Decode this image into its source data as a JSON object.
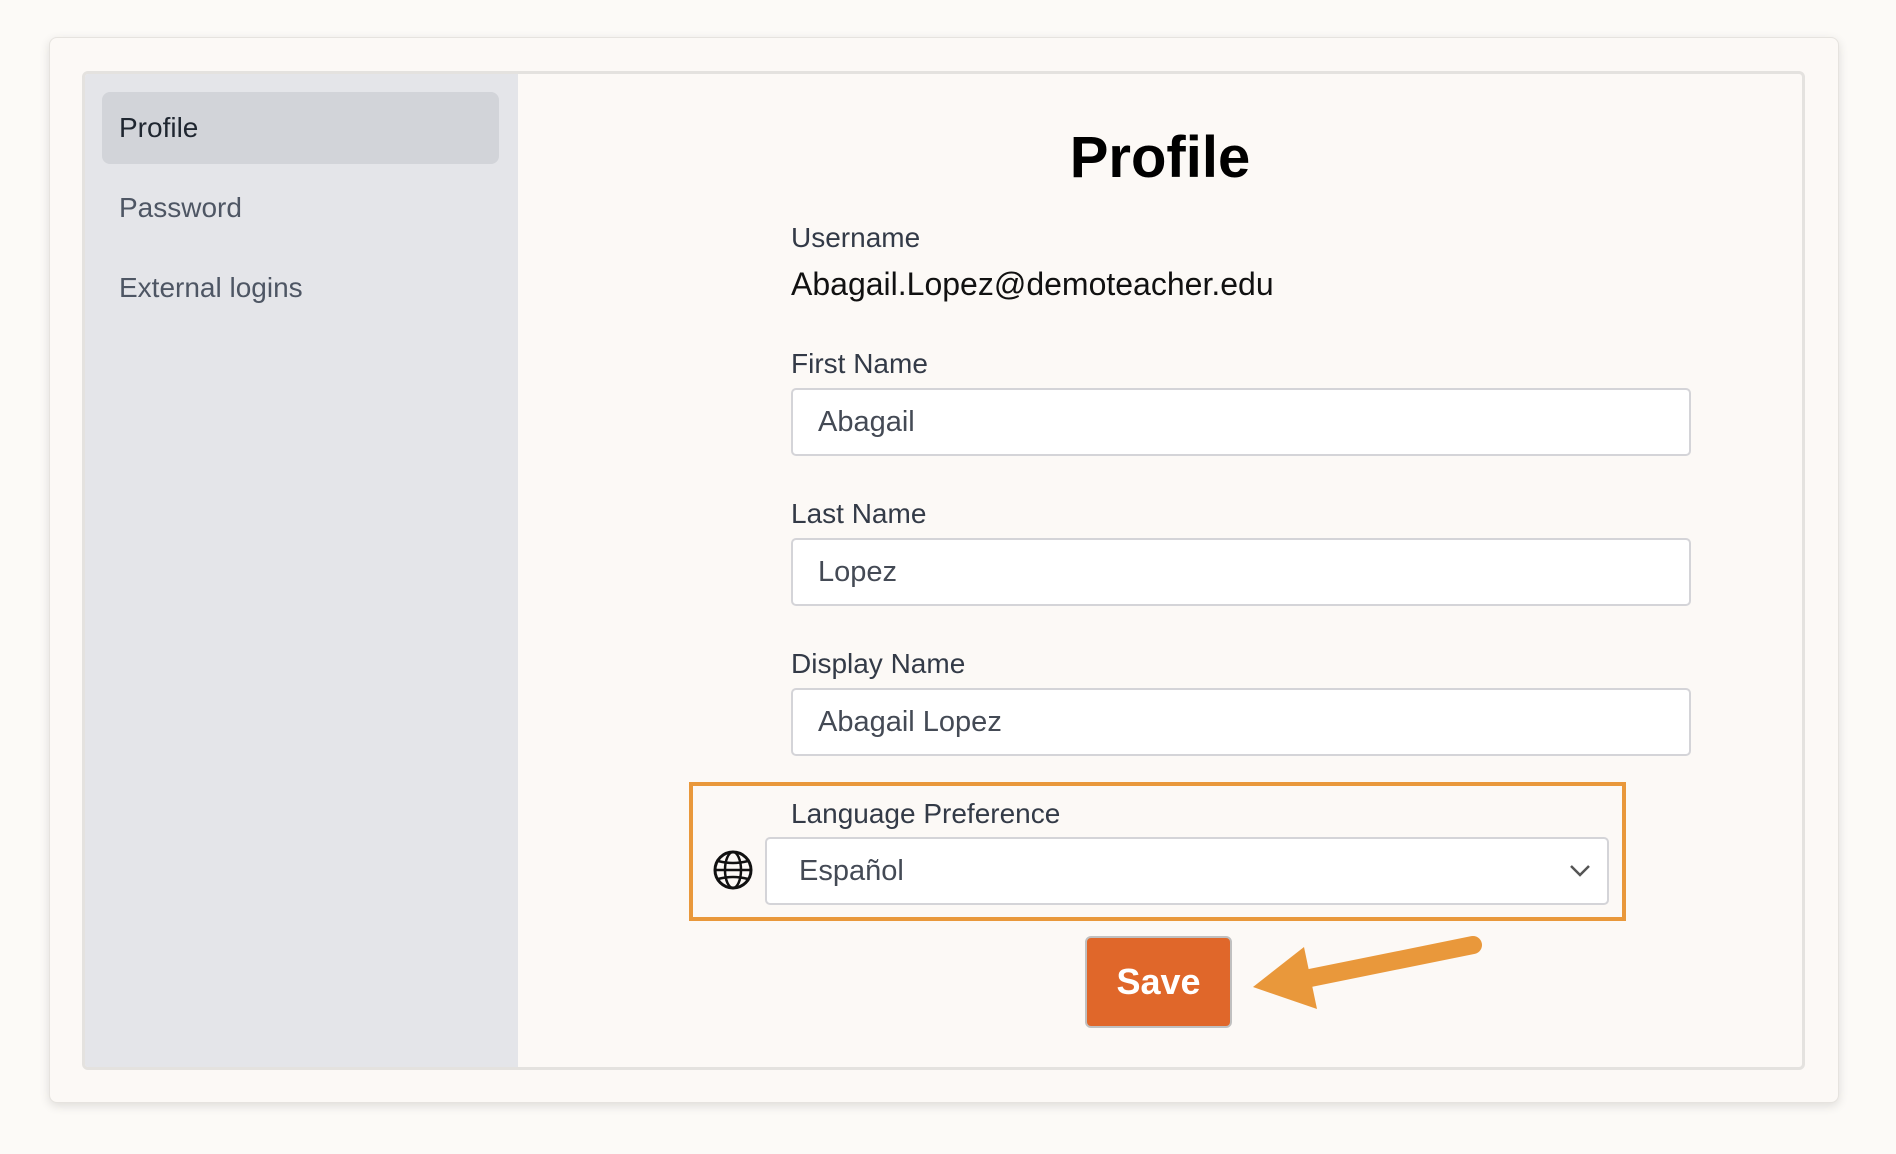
{
  "sidebar": {
    "items": [
      {
        "label": "Profile",
        "active": true
      },
      {
        "label": "Password",
        "active": false
      },
      {
        "label": "External logins",
        "active": false
      }
    ]
  },
  "main": {
    "title": "Profile",
    "username": {
      "label": "Username",
      "value": "Abagail.Lopez@demoteacher.edu"
    },
    "first_name": {
      "label": "First Name",
      "value": "Abagail"
    },
    "last_name": {
      "label": "Last Name",
      "value": "Lopez"
    },
    "display_name": {
      "label": "Display Name",
      "value": "Abagail Lopez"
    },
    "language": {
      "label": "Language Preference",
      "selected": "Español",
      "icon": "globe-icon"
    },
    "save_label": "Save"
  },
  "colors": {
    "accent": "#e0672a",
    "highlight": "#e9983b",
    "sidebar_bg": "#e4e5e9"
  }
}
